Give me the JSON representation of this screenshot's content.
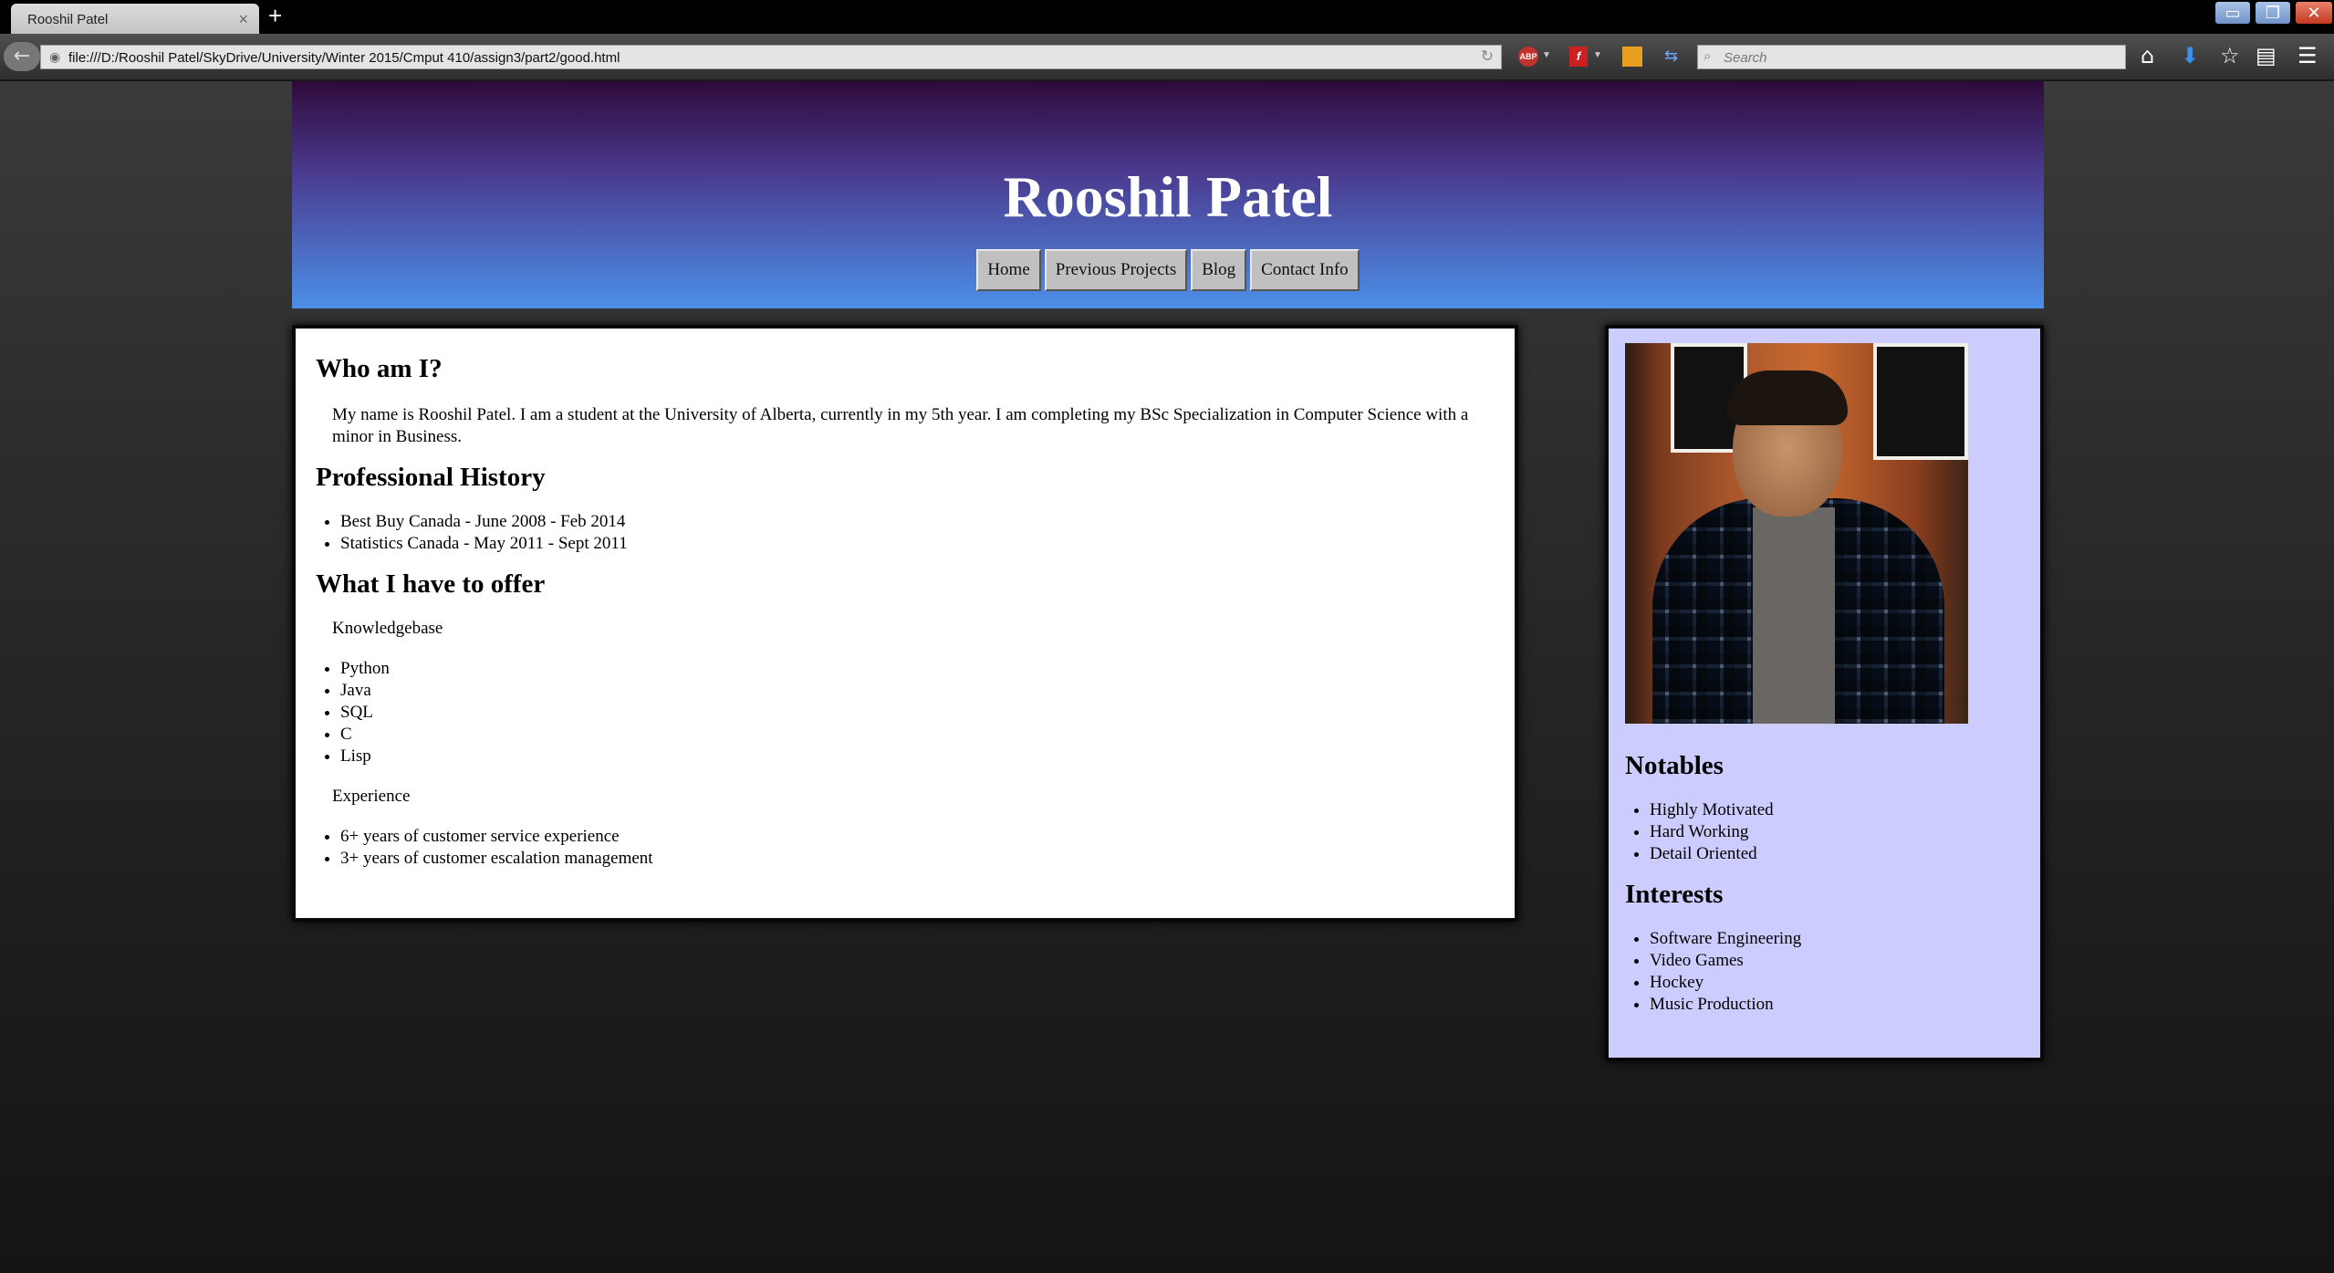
{
  "browser": {
    "tab_title": "Rooshil Patel",
    "url": "file:///D:/Rooshil Patel/SkyDrive/University/Winter 2015/Cmput 410/assign3/part2/good.html",
    "search_placeholder": "Search",
    "abp_label": "ABP"
  },
  "header": {
    "title": "Rooshil Patel",
    "nav": [
      "Home",
      "Previous Projects",
      "Blog",
      "Contact Info"
    ]
  },
  "main": {
    "about_heading": "Who am I?",
    "about_text": "My name is Rooshil Patel. I am a student at the University of Alberta, currently in my 5th year. I am completing my BSc Specialization in Computer Science with a minor in Business.",
    "history_heading": "Professional History",
    "history": [
      "Best Buy Canada - June 2008 - Feb 2014",
      "Statistics Canada - May 2011 - Sept 2011"
    ],
    "offer_heading": "What I have to offer",
    "knowledge_label": "Knowledgebase",
    "knowledge": [
      "Python",
      "Java",
      "SQL",
      "C",
      "Lisp"
    ],
    "experience_label": "Experience",
    "experience": [
      "6+ years of customer service experience",
      "3+ years of customer escalation management"
    ]
  },
  "sidebar": {
    "notables_heading": "Notables",
    "notables": [
      "Highly Motivated",
      "Hard Working",
      "Detail Oriented"
    ],
    "interests_heading": "Interests",
    "interests": [
      "Software Engineering",
      "Video Games",
      "Hockey",
      "Music Production"
    ]
  }
}
